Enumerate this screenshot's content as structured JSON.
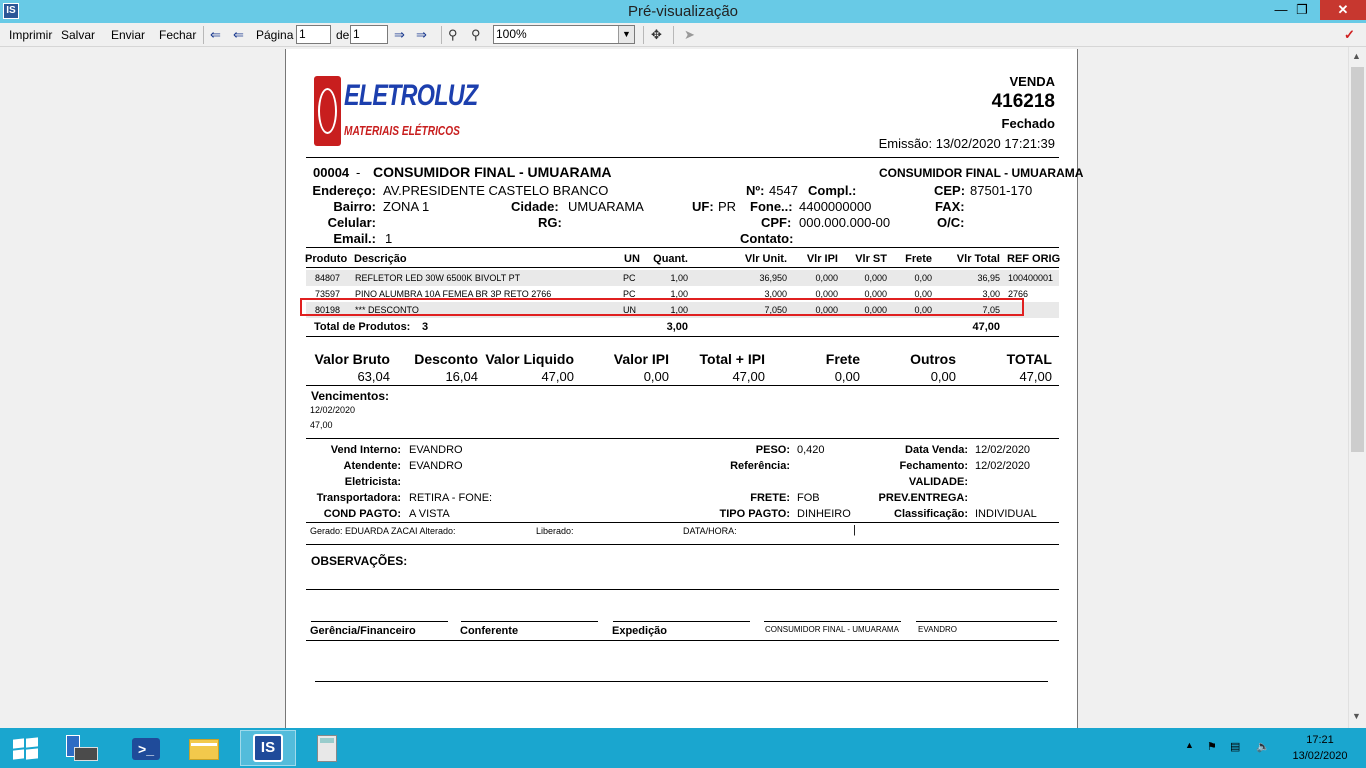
{
  "window": {
    "title": "Pré-visualização"
  },
  "toolbar": {
    "print": "Imprimir",
    "save": "Salvar",
    "send": "Enviar",
    "close": "Fechar",
    "page_label": "Página",
    "page_value": "1",
    "of_label": "de",
    "total_pages": "1",
    "zoom": "100%"
  },
  "doc": {
    "logo_top": "ELETROLUZ",
    "logo_bottom": "MATERIAIS ELÉTRICOS",
    "header": {
      "type": "VENDA",
      "number": "416218",
      "status": "Fechado",
      "emission": "Emissão: 13/02/2020 17:21:39"
    },
    "customer": {
      "code": "00004",
      "dash": "-",
      "name": "CONSUMIDOR FINAL - UMUARAMA",
      "name_right": "CONSUMIDOR FINAL - UMUARAMA",
      "address_label": "Endereço:",
      "address": "AV.PRESIDENTE CASTELO BRANCO",
      "number_label": "Nº:",
      "number": "4547",
      "compl_label": "Compl.:",
      "cep_label": "CEP:",
      "cep": "87501-170",
      "bairro_label": "Bairro:",
      "bairro": "ZONA 1",
      "cidade_label": "Cidade:",
      "cidade": "UMUARAMA",
      "uf_label": "UF:",
      "uf": "PR",
      "fone_label": "Fone..:",
      "fone": "4400000000",
      "fax_label": "FAX:",
      "celular_label": "Celular:",
      "rg_label": "RG:",
      "cpf_label": "CPF:",
      "cpf": "000.000.000-00",
      "oc_label": "O/C:",
      "email_label": "Email.:",
      "email": "1",
      "contato_label": "Contato:"
    },
    "items_headers": [
      "Produto",
      "Descrição",
      "UN",
      "Quant.",
      "Vlr Unit.",
      "Vlr IPI",
      "Vlr ST",
      "Frete",
      "Vlr Total",
      "REF ORIG"
    ],
    "items": [
      {
        "produto": "84807",
        "descricao": "REFLETOR LED  30W 6500K BIVOLT  PT",
        "un": "PC",
        "quant": "1,00",
        "unit": "36,950",
        "ipi": "0,000",
        "st": "0,000",
        "frete": "0,00",
        "total": "36,95",
        "ref": "100400001"
      },
      {
        "produto": "73597",
        "descricao": "PINO ALUMBRA 10A FEMEA BR 3P RETO  2766",
        "un": "PC",
        "quant": "1,00",
        "unit": "3,000",
        "ipi": "0,000",
        "st": "0,000",
        "frete": "0,00",
        "total": "3,00",
        "ref": "2766"
      },
      {
        "produto": "80198",
        "descricao": "*** DESCONTO",
        "un": "UN",
        "quant": "1,00",
        "unit": "7,050",
        "ipi": "0,000",
        "st": "0,000",
        "frete": "0,00",
        "total": "7,05",
        "ref": ""
      }
    ],
    "totals_line": {
      "label": "Total de Produtos:",
      "count": "3",
      "quant": "3,00",
      "total": "47,00"
    },
    "summary": {
      "headers": [
        "Valor Bruto",
        "Desconto",
        "Valor Liquido",
        "Valor IPI",
        "Total + IPI",
        "Frete",
        "Outros",
        "TOTAL"
      ],
      "values": [
        "63,04",
        "16,04",
        "47,00",
        "0,00",
        "47,00",
        "0,00",
        "0,00",
        "47,00"
      ]
    },
    "vencimentos": {
      "label": "Vencimentos:",
      "date": "12/02/2020",
      "value": "47,00"
    },
    "info": {
      "vend_label": "Vend Interno:",
      "vend": "EVANDRO",
      "peso_label": "PESO:",
      "peso": "0,420",
      "data_venda_label": "Data Venda:",
      "data_venda": "12/02/2020",
      "atendente_label": "Atendente:",
      "atendente": "EVANDRO",
      "referencia_label": "Referência:",
      "fechamento_label": "Fechamento:",
      "fechamento": "12/02/2020",
      "eletricista_label": "Eletricista:",
      "validade_label": "VALIDADE:",
      "transportadora_label": "Transportadora:",
      "transportadora": "RETIRA - FONE:",
      "frete_label": "FRETE:",
      "frete": "FOB",
      "prev_label": "PREV.ENTREGA:",
      "cond_label": "COND PAGTO:",
      "cond": "A VISTA",
      "tipo_label": "TIPO PAGTO:",
      "tipo": "DINHEIRO",
      "class_label": "Classificação:",
      "class": "INDIVIDUAL"
    },
    "gerado_line": {
      "gerado": "Gerado:  EDUARDA ZACAI Alterado:",
      "liberado": "Liberado:",
      "datahora": "DATA/HORA:",
      "bar": "|"
    },
    "observacoes": "OBSERVAÇÕES:",
    "signatures": [
      "Gerência/Financeiro",
      "Conferente",
      "Expedição",
      "CONSUMIDOR FINAL - UMUARAMA",
      "EVANDRO"
    ]
  },
  "taskbar": {
    "time": "17:21",
    "date": "13/02/2020"
  },
  "colors": {
    "titlebar": "#68cae6",
    "taskbar": "#1aa6cf",
    "highlight": "#e02020",
    "close": "#c7372f"
  }
}
